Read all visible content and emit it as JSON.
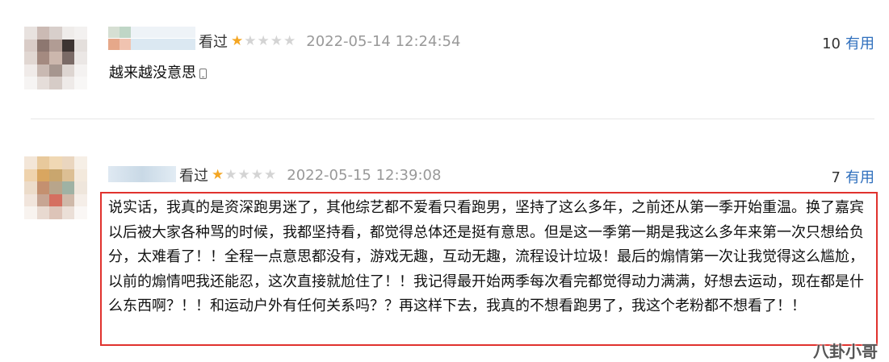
{
  "comments": [
    {
      "status": "看过",
      "rating": 1,
      "max_rating": 5,
      "date": "2022-05-14 12:24:54",
      "useful_count": "10",
      "useful_label": "有用",
      "text": "越来越没意思"
    },
    {
      "status": "看过",
      "rating": 1,
      "max_rating": 5,
      "date": "2022-05-15 12:39:08",
      "useful_count": "7",
      "useful_label": "有用",
      "text": "说实话，我真的是资深跑男迷了，其他综艺都不爱看只看跑男，坚持了这么多年，之前还从第一季开始重温。换了嘉宾以后被大家各种骂的时候，我都坚持看，都觉得总体还是挺有意思。但是这一季第一期是我这么多年来第一次只想给负分，太难看了！！全程一点意思都没有，游戏无趣，互动无趣，流程设计垃圾！最后的煽情第一次让我觉得这么尴尬，以前的煽情吧我还能忍，这次直接就尬住了！！我记得最开始两季每次看完都觉得动力满满，好想去运动，现在都是什么东西啊？！！和运动户外有任何关系吗？？再这样下去，我真的不想看跑男了，我这个老粉都不想看了！！"
    }
  ],
  "watermark": "八卦小哥",
  "colors": {
    "star_on": "#f4a623",
    "star_off": "#d4d4d4",
    "link": "#2f6fbd",
    "highlight_border": "#e0322e",
    "date": "#999999"
  },
  "icons": [
    "star-icon",
    "mobile-phone-icon"
  ]
}
